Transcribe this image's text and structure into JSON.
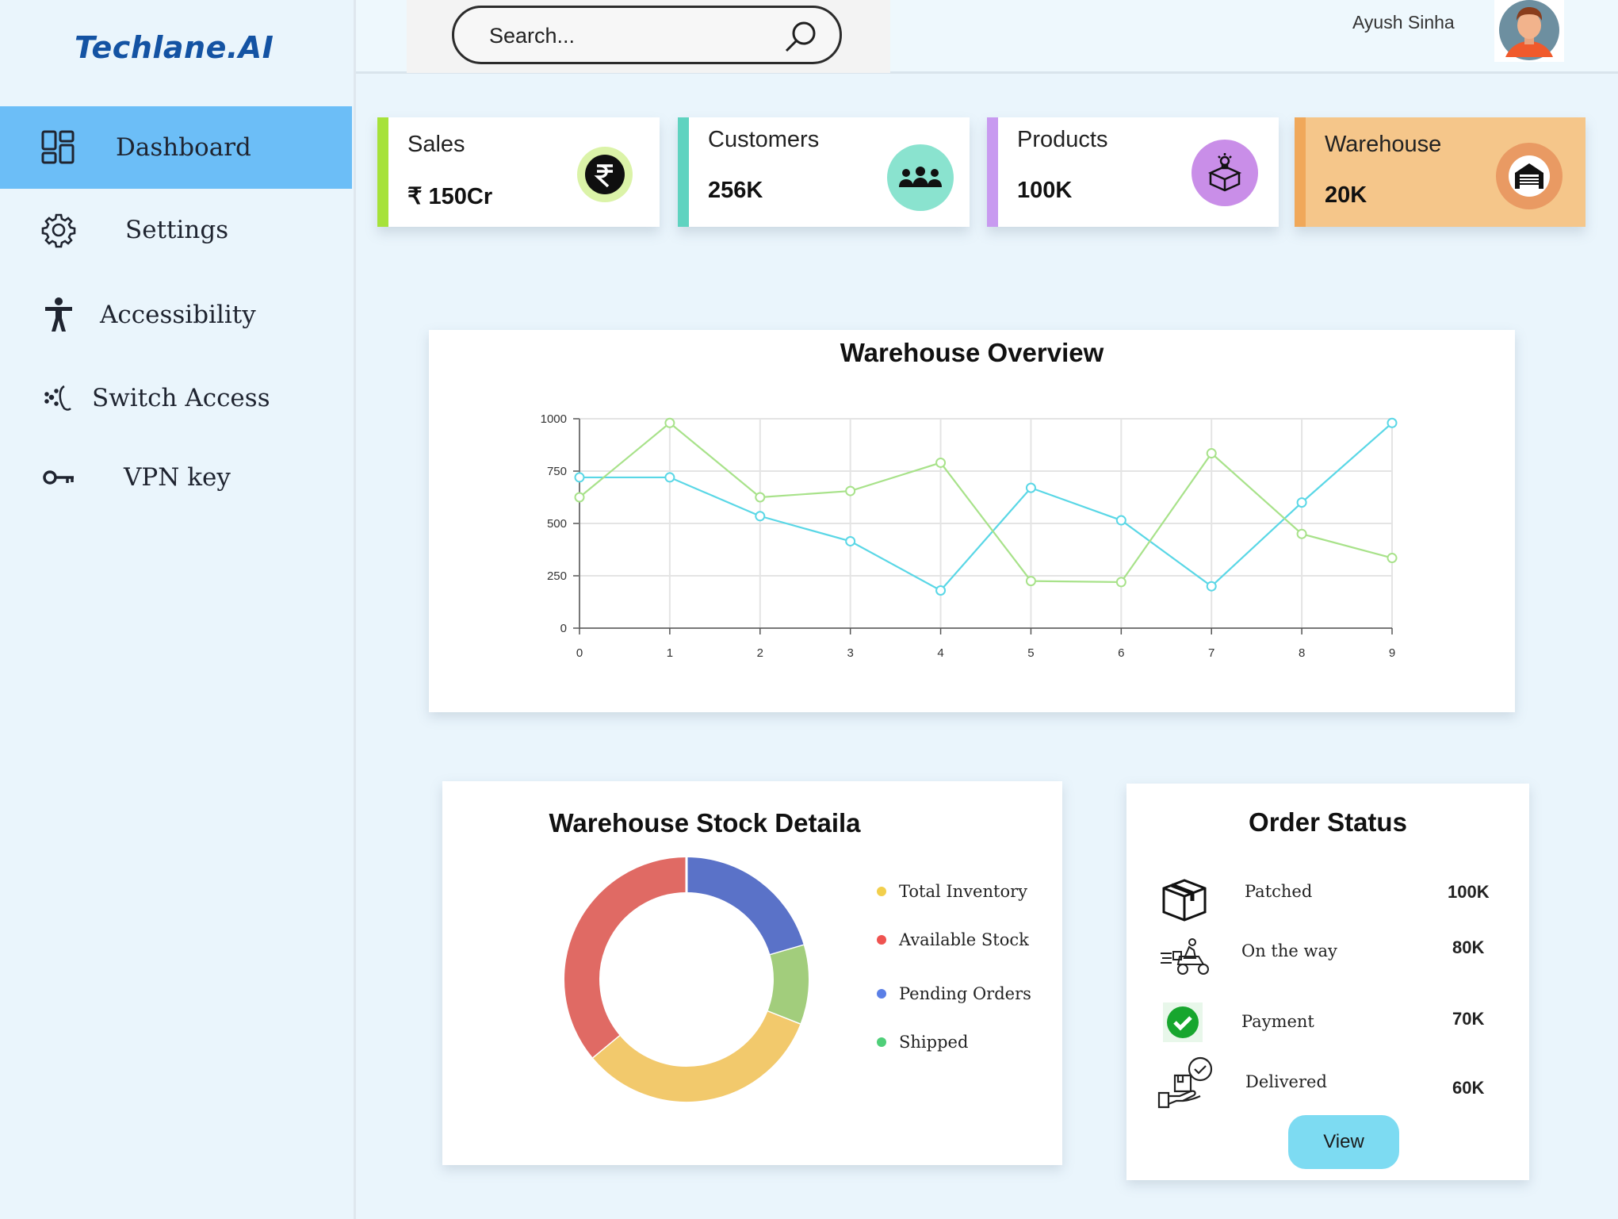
{
  "brand": {
    "name": "Techlane.AI"
  },
  "sidebar": {
    "items": [
      {
        "label": "Dashboard",
        "icon": "dashboard-icon",
        "active": true
      },
      {
        "label": "Settings",
        "icon": "gear-icon",
        "active": false
      },
      {
        "label": "Accessibility",
        "icon": "accessibility-icon",
        "active": false
      },
      {
        "label": "Switch Access",
        "icon": "switch-access-icon",
        "active": false
      },
      {
        "label": "VPN key",
        "icon": "key-icon",
        "active": false
      }
    ]
  },
  "header": {
    "search_placeholder": "Search...",
    "user_name": "Ayush Sinha"
  },
  "stats": [
    {
      "title": "Sales",
      "value": "₹ 150Cr",
      "accent": "#a6e23a",
      "icon": "rupee-icon",
      "highlight": false
    },
    {
      "title": "Customers",
      "value": "256K",
      "accent": "#5fd3c0",
      "icon": "users-group-icon",
      "highlight": false
    },
    {
      "title": "Products",
      "value": "100K",
      "accent": "#c89af0",
      "icon": "product-box-icon",
      "highlight": false
    },
    {
      "title": "Warehouse",
      "value": "20K",
      "accent": "#f0a85a",
      "icon": "warehouse-icon",
      "highlight": true
    }
  ],
  "overview": {
    "title": "Warehouse Overview"
  },
  "stock": {
    "title": "Warehouse Stock Detaila",
    "legend": [
      {
        "label": "Total Inventory",
        "color": "#f2cf4c"
      },
      {
        "label": "Available Stock",
        "color": "#ef5350"
      },
      {
        "label": "Pending Orders",
        "color": "#5b7fe6"
      },
      {
        "label": "Shipped",
        "color": "#4fcf79"
      }
    ]
  },
  "orders": {
    "title": "Order Status",
    "rows": [
      {
        "label": "Patched",
        "value": "100K",
        "icon": "package-box-icon"
      },
      {
        "label": "On the way",
        "value": "80K",
        "icon": "delivery-scooter-icon"
      },
      {
        "label": "Payment",
        "value": "70K",
        "icon": "check-circle-icon"
      },
      {
        "label": "Delivered",
        "value": "60K",
        "icon": "delivered-package-icon"
      }
    ],
    "view_label": "View"
  },
  "chart_data": [
    {
      "type": "line",
      "title": "Warehouse Overview",
      "x": [
        0,
        1,
        2,
        3,
        4,
        5,
        6,
        7,
        8,
        9
      ],
      "series": [
        {
          "color": "#5ad7e6",
          "values": [
            720,
            720,
            535,
            415,
            180,
            670,
            515,
            200,
            600,
            980
          ]
        },
        {
          "color": "#a8e28a",
          "values": [
            625,
            980,
            625,
            655,
            790,
            225,
            220,
            835,
            450,
            335
          ]
        }
      ],
      "xlim": [
        0,
        9
      ],
      "ylim": [
        0,
        1000
      ],
      "yticks": [
        0,
        250,
        500,
        750,
        1000
      ],
      "grid": true
    },
    {
      "type": "pie",
      "title": "Warehouse Stock Detaila",
      "donut": true,
      "slices": [
        {
          "label": "Pending Orders",
          "value": 20.5,
          "color": "#5a72c8"
        },
        {
          "label": "Shipped",
          "value": 10.5,
          "color": "#a2cd7c"
        },
        {
          "label": "Total Inventory",
          "value": 33,
          "color": "#f2c96c"
        },
        {
          "label": "Available Stock",
          "value": 36,
          "color": "#e06a64"
        }
      ]
    }
  ]
}
